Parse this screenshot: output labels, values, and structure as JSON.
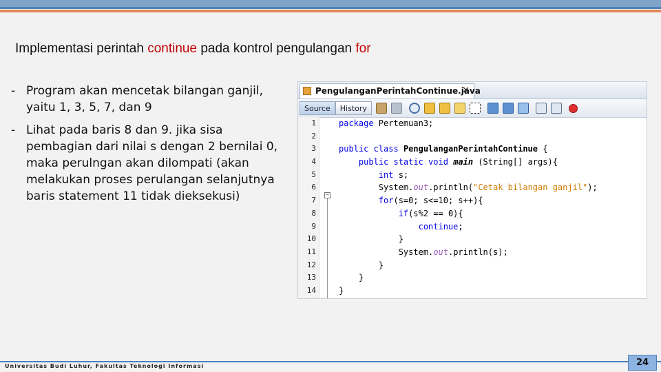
{
  "slide": {
    "title_parts": [
      "Implementasi perintah ",
      "continue",
      " pada kontrol pengulangan ",
      "for"
    ],
    "bullets": [
      {
        "marker": "-",
        "text": "Program akan mencetak bilangan ganjil, yaitu 1, 3, 5, 7, dan 9"
      },
      {
        "marker": "-",
        "text": "Lihat pada baris 8 dan 9. jika sisa pembagian dari nilai s dengan 2 bernilai 0, maka perulngan akan dilompati (akan melakukan proses perulangan selanjutnya baris statement 11 tidak dieksekusi)"
      }
    ],
    "footer_text": "Universitas Budi Luhur, Fakultas Teknologi Informasi",
    "page_number": "24",
    "colors": {
      "keyword_red": "#c00000",
      "accent_blue": "#4f81bd",
      "accent_orange": "#e0885a"
    }
  },
  "ide": {
    "file_tab": "PengulanganPerintahContinue.java",
    "close_glyph": "✕",
    "source_tab": "Source",
    "history_tab": "History",
    "toolbar_icons": [
      "back-icon",
      "forward-icon",
      "search-icon",
      "prev-occurrence-icon",
      "next-occurrence-icon",
      "toggle-highlight-icon",
      "toggle-rect-select-icon",
      "prev-bookmark-icon",
      "next-bookmark-icon",
      "toggle-bookmark-icon",
      "shift-left-icon",
      "shift-right-icon",
      "start-macro-icon"
    ],
    "line_numbers": [
      "1",
      "2",
      "3",
      "4",
      "5",
      "6",
      "7",
      "8",
      "9",
      "10",
      "11",
      "12",
      "13",
      "14"
    ],
    "fold_glyph": "−"
  }
}
